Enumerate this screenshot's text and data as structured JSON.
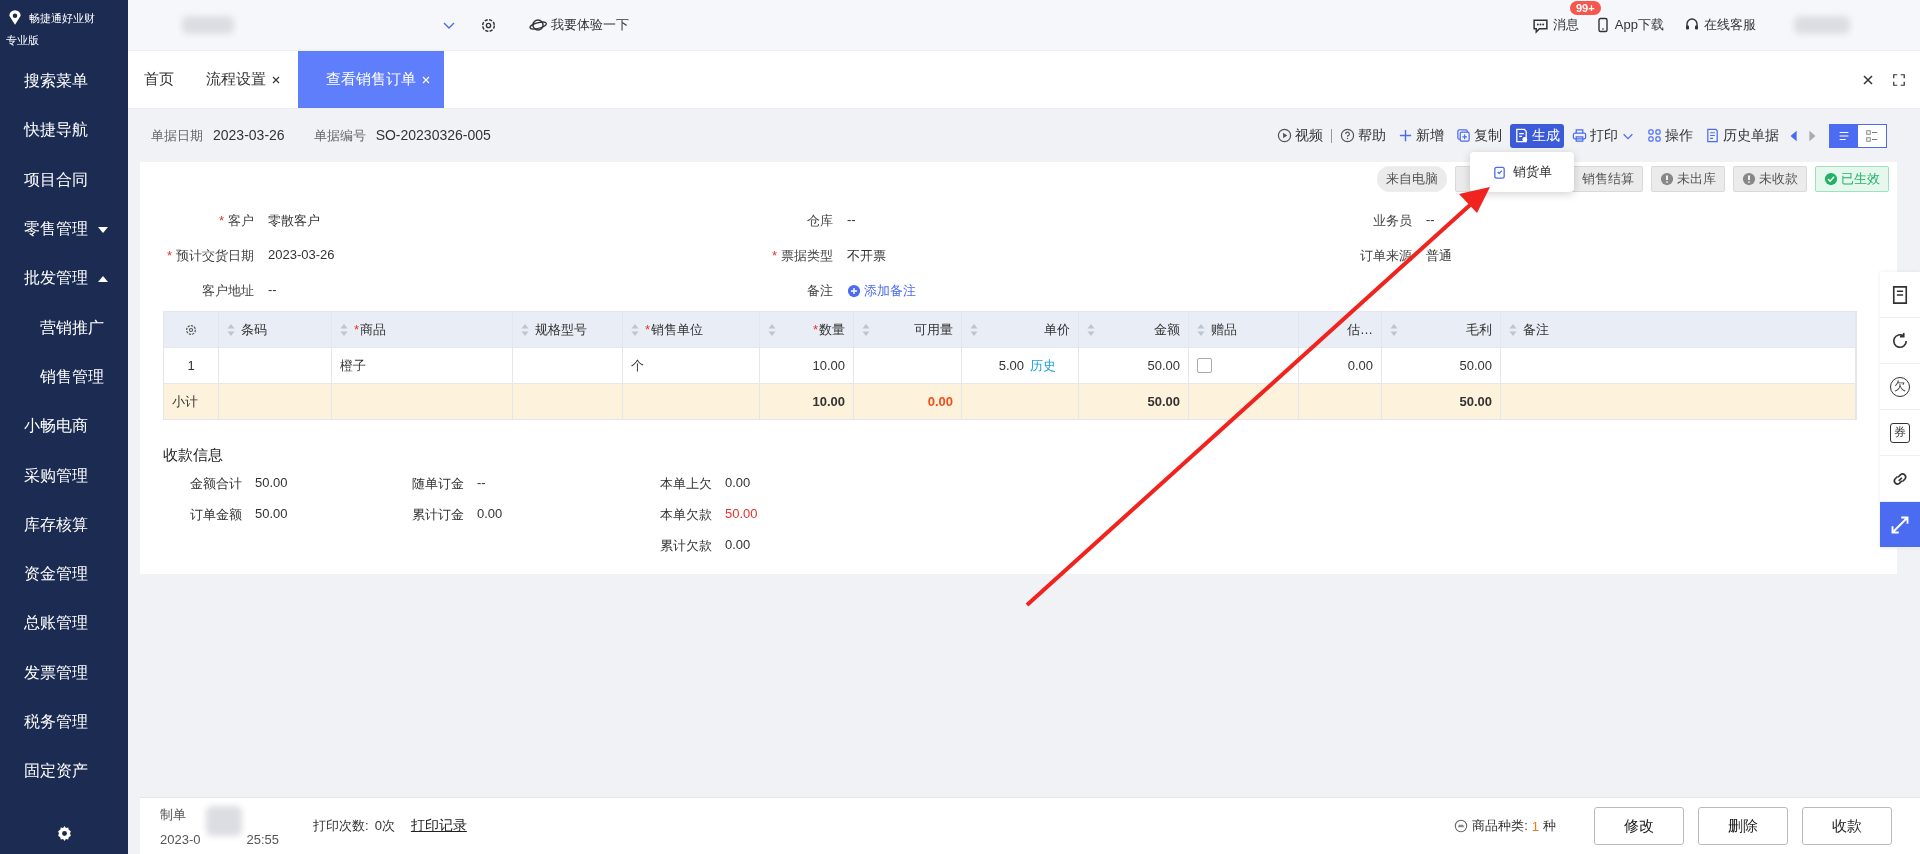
{
  "app": {
    "name": "畅捷通好业财",
    "edition": "专业版"
  },
  "topbar": {
    "trial": "我要体验一下",
    "messages": {
      "label": "消息",
      "badge": "99+"
    },
    "app_download": "App下载",
    "support": "在线客服"
  },
  "sidebar": {
    "items": [
      {
        "label": "搜索菜单"
      },
      {
        "label": "快捷导航"
      },
      {
        "label": "项目合同"
      },
      {
        "label": "零售管理",
        "expanded": false
      },
      {
        "label": "批发管理",
        "expanded": true,
        "children": [
          {
            "label": "营销推广"
          },
          {
            "label": "销售管理"
          }
        ]
      },
      {
        "label": "小畅电商"
      },
      {
        "label": "采购管理"
      },
      {
        "label": "库存核算"
      },
      {
        "label": "资金管理"
      },
      {
        "label": "总账管理"
      },
      {
        "label": "发票管理"
      },
      {
        "label": "税务管理"
      },
      {
        "label": "固定资产"
      }
    ]
  },
  "tabs": [
    {
      "label": "首页",
      "closable": false,
      "selected": false
    },
    {
      "label": "流程设置",
      "closable": true,
      "selected": false
    },
    {
      "label": "查看销售订单",
      "closable": true,
      "selected": true
    }
  ],
  "header": {
    "fields": [
      {
        "label": "单据日期",
        "value": "2023-03-26"
      },
      {
        "label": "单据编号",
        "value": "SO-20230326-005"
      }
    ]
  },
  "toolbar": [
    {
      "label": "视频",
      "kind": "play",
      "selected": false
    },
    {
      "label": "帮助",
      "kind": "help",
      "selected": false
    },
    {
      "label": "新增",
      "kind": "plus",
      "selected": false
    },
    {
      "label": "复制",
      "kind": "copy",
      "selected": false
    },
    {
      "label": "生成",
      "kind": "doc",
      "selected": true
    },
    {
      "label": "打印",
      "kind": "print",
      "selected": false,
      "dropdown": true
    },
    {
      "label": "操作",
      "kind": "grid",
      "selected": false
    },
    {
      "label": "历史单据",
      "kind": "history",
      "selected": false
    }
  ],
  "view_toggle": [
    {
      "kind": "list",
      "selected": true
    },
    {
      "kind": "detail",
      "selected": false
    }
  ],
  "generate_menu": {
    "items": [
      "销货单"
    ]
  },
  "status_tags": [
    {
      "label": "来自电脑",
      "kind": "source"
    },
    {
      "label": "销售结算",
      "kind": "pending"
    },
    {
      "label": "未出库",
      "kind": "pending"
    },
    {
      "label": "未收款",
      "kind": "pending"
    },
    {
      "label": "已生效",
      "kind": "done"
    }
  ],
  "form": {
    "fields": [
      {
        "mark": "*",
        "label": "客户",
        "value": "零散客户"
      },
      {
        "label": "仓库",
        "value": "--"
      },
      {
        "label": "业务员",
        "value": "--"
      },
      {
        "mark": "*",
        "label": "预计交货日期",
        "value": "2023-03-26"
      },
      {
        "mark": "*",
        "label": "票据类型",
        "value": "不开票"
      },
      {
        "label": "订单来源",
        "value": "普通"
      },
      {
        "label": "客户地址",
        "value": "--"
      },
      {
        "label": "备注",
        "link": "添加备注"
      }
    ]
  },
  "table": {
    "columns": [
      {
        "kind": "settings"
      },
      {
        "label": "条码",
        "sortable": true
      },
      {
        "mark": "*",
        "label": "商品",
        "sortable": true
      },
      {
        "label": "规格型号",
        "sortable": true
      },
      {
        "mark": "*",
        "label": "销售单位",
        "sortable": true
      },
      {
        "mark": "*",
        "label": "数量",
        "sortable": true
      },
      {
        "label": "可用量",
        "sortable": true
      },
      {
        "label": "单价",
        "sortable": true
      },
      {
        "label": "金额",
        "sortable": true
      },
      {
        "label": "赠品",
        "sortable": true
      },
      {
        "label": "估…",
        "sortable": false
      },
      {
        "label": "毛利",
        "sortable": true
      },
      {
        "label": "备注",
        "sortable": true
      }
    ],
    "rows": [
      {
        "cells": [
          "1",
          null,
          "橙子",
          null,
          "个",
          "10.00",
          null,
          {
            "text": "5.00",
            "link": "历史"
          },
          "50.00",
          {
            "kind": "checkbox",
            "checked": false
          },
          "0.00",
          "50.00",
          null
        ]
      }
    ],
    "subtotal": {
      "label": "小计",
      "cells": [
        null,
        null,
        null,
        null,
        {
          "text": "10.00",
          "alert": false
        },
        {
          "text": "0.00",
          "alert": true
        },
        null,
        {
          "text": "50.00",
          "alert": false
        },
        null,
        null,
        {
          "text": "50.00",
          "alert": false
        },
        null
      ]
    }
  },
  "payment": {
    "title": "收款信息",
    "columns": [
      [
        {
          "label": "金额合计",
          "value": "50.00",
          "alert": false
        },
        {
          "label": "订单金额",
          "value": "50.00",
          "alert": false
        }
      ],
      [
        {
          "label": "随单订金",
          "value": "--",
          "alert": false
        },
        {
          "label": "累计订金",
          "value": "0.00",
          "alert": false
        }
      ],
      [
        {
          "label": "本单上欠",
          "value": "0.00",
          "alert": false
        },
        {
          "label": "本单欠款",
          "value": "50.00",
          "alert": true
        },
        {
          "label": "累计欠款",
          "value": "0.00",
          "alert": false
        }
      ]
    ]
  },
  "side_tools": [
    {
      "kind": "form",
      "selected": false
    },
    {
      "kind": "refresh",
      "selected": false
    },
    {
      "kind": "glyph",
      "text": "欠",
      "selected": false
    },
    {
      "kind": "glyph",
      "text": "券",
      "selected": false
    },
    {
      "kind": "link",
      "selected": false
    },
    {
      "kind": "expand",
      "selected": true
    }
  ],
  "footer": {
    "creator_label": "制单",
    "time_start": "2023-0",
    "time_end": "25:55",
    "print_count_label": "打印次数:",
    "print_count": "0次",
    "print_log": "打印记录",
    "kinds_label": "商品种类:",
    "kinds_count": "1",
    "kinds_unit": "种",
    "buttons": [
      "修改",
      "删除",
      "收款"
    ]
  }
}
